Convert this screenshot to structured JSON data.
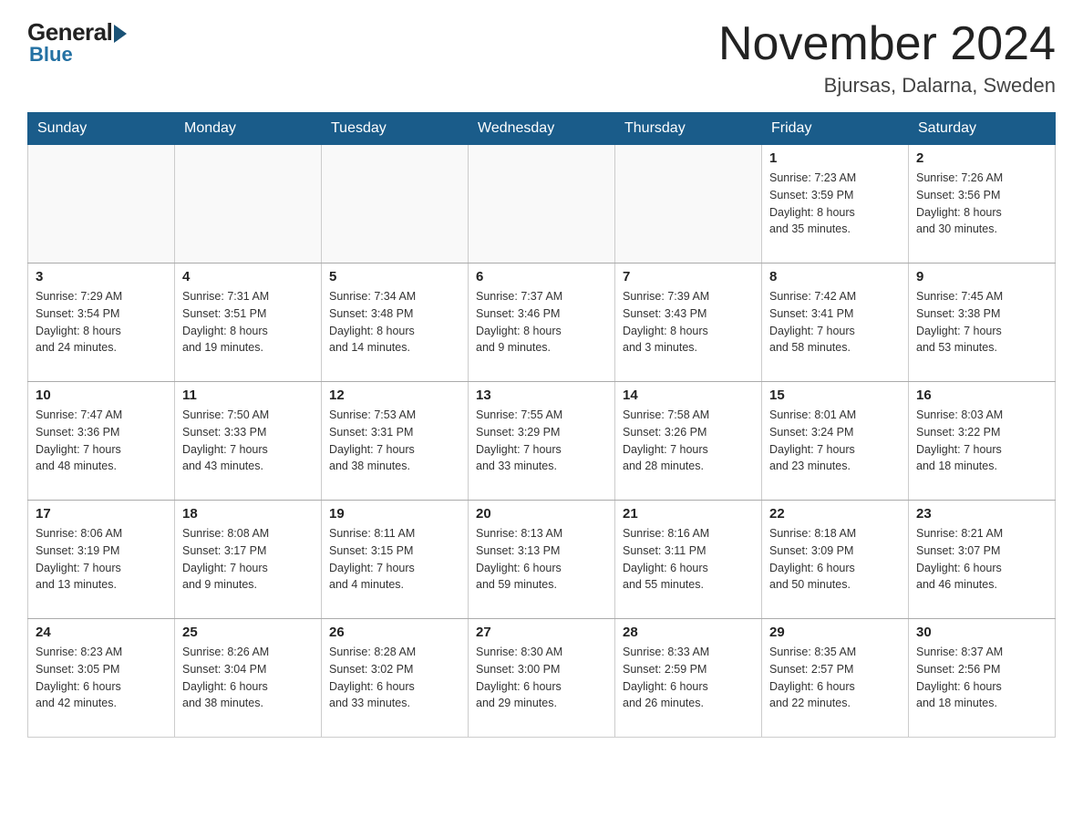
{
  "header": {
    "logo": {
      "general": "General",
      "blue": "Blue"
    },
    "title": "November 2024",
    "location": "Bjursas, Dalarna, Sweden"
  },
  "days_of_week": [
    "Sunday",
    "Monday",
    "Tuesday",
    "Wednesday",
    "Thursday",
    "Friday",
    "Saturday"
  ],
  "weeks": [
    [
      {
        "day": "",
        "info": ""
      },
      {
        "day": "",
        "info": ""
      },
      {
        "day": "",
        "info": ""
      },
      {
        "day": "",
        "info": ""
      },
      {
        "day": "",
        "info": ""
      },
      {
        "day": "1",
        "info": "Sunrise: 7:23 AM\nSunset: 3:59 PM\nDaylight: 8 hours\nand 35 minutes."
      },
      {
        "day": "2",
        "info": "Sunrise: 7:26 AM\nSunset: 3:56 PM\nDaylight: 8 hours\nand 30 minutes."
      }
    ],
    [
      {
        "day": "3",
        "info": "Sunrise: 7:29 AM\nSunset: 3:54 PM\nDaylight: 8 hours\nand 24 minutes."
      },
      {
        "day": "4",
        "info": "Sunrise: 7:31 AM\nSunset: 3:51 PM\nDaylight: 8 hours\nand 19 minutes."
      },
      {
        "day": "5",
        "info": "Sunrise: 7:34 AM\nSunset: 3:48 PM\nDaylight: 8 hours\nand 14 minutes."
      },
      {
        "day": "6",
        "info": "Sunrise: 7:37 AM\nSunset: 3:46 PM\nDaylight: 8 hours\nand 9 minutes."
      },
      {
        "day": "7",
        "info": "Sunrise: 7:39 AM\nSunset: 3:43 PM\nDaylight: 8 hours\nand 3 minutes."
      },
      {
        "day": "8",
        "info": "Sunrise: 7:42 AM\nSunset: 3:41 PM\nDaylight: 7 hours\nand 58 minutes."
      },
      {
        "day": "9",
        "info": "Sunrise: 7:45 AM\nSunset: 3:38 PM\nDaylight: 7 hours\nand 53 minutes."
      }
    ],
    [
      {
        "day": "10",
        "info": "Sunrise: 7:47 AM\nSunset: 3:36 PM\nDaylight: 7 hours\nand 48 minutes."
      },
      {
        "day": "11",
        "info": "Sunrise: 7:50 AM\nSunset: 3:33 PM\nDaylight: 7 hours\nand 43 minutes."
      },
      {
        "day": "12",
        "info": "Sunrise: 7:53 AM\nSunset: 3:31 PM\nDaylight: 7 hours\nand 38 minutes."
      },
      {
        "day": "13",
        "info": "Sunrise: 7:55 AM\nSunset: 3:29 PM\nDaylight: 7 hours\nand 33 minutes."
      },
      {
        "day": "14",
        "info": "Sunrise: 7:58 AM\nSunset: 3:26 PM\nDaylight: 7 hours\nand 28 minutes."
      },
      {
        "day": "15",
        "info": "Sunrise: 8:01 AM\nSunset: 3:24 PM\nDaylight: 7 hours\nand 23 minutes."
      },
      {
        "day": "16",
        "info": "Sunrise: 8:03 AM\nSunset: 3:22 PM\nDaylight: 7 hours\nand 18 minutes."
      }
    ],
    [
      {
        "day": "17",
        "info": "Sunrise: 8:06 AM\nSunset: 3:19 PM\nDaylight: 7 hours\nand 13 minutes."
      },
      {
        "day": "18",
        "info": "Sunrise: 8:08 AM\nSunset: 3:17 PM\nDaylight: 7 hours\nand 9 minutes."
      },
      {
        "day": "19",
        "info": "Sunrise: 8:11 AM\nSunset: 3:15 PM\nDaylight: 7 hours\nand 4 minutes."
      },
      {
        "day": "20",
        "info": "Sunrise: 8:13 AM\nSunset: 3:13 PM\nDaylight: 6 hours\nand 59 minutes."
      },
      {
        "day": "21",
        "info": "Sunrise: 8:16 AM\nSunset: 3:11 PM\nDaylight: 6 hours\nand 55 minutes."
      },
      {
        "day": "22",
        "info": "Sunrise: 8:18 AM\nSunset: 3:09 PM\nDaylight: 6 hours\nand 50 minutes."
      },
      {
        "day": "23",
        "info": "Sunrise: 8:21 AM\nSunset: 3:07 PM\nDaylight: 6 hours\nand 46 minutes."
      }
    ],
    [
      {
        "day": "24",
        "info": "Sunrise: 8:23 AM\nSunset: 3:05 PM\nDaylight: 6 hours\nand 42 minutes."
      },
      {
        "day": "25",
        "info": "Sunrise: 8:26 AM\nSunset: 3:04 PM\nDaylight: 6 hours\nand 38 minutes."
      },
      {
        "day": "26",
        "info": "Sunrise: 8:28 AM\nSunset: 3:02 PM\nDaylight: 6 hours\nand 33 minutes."
      },
      {
        "day": "27",
        "info": "Sunrise: 8:30 AM\nSunset: 3:00 PM\nDaylight: 6 hours\nand 29 minutes."
      },
      {
        "day": "28",
        "info": "Sunrise: 8:33 AM\nSunset: 2:59 PM\nDaylight: 6 hours\nand 26 minutes."
      },
      {
        "day": "29",
        "info": "Sunrise: 8:35 AM\nSunset: 2:57 PM\nDaylight: 6 hours\nand 22 minutes."
      },
      {
        "day": "30",
        "info": "Sunrise: 8:37 AM\nSunset: 2:56 PM\nDaylight: 6 hours\nand 18 minutes."
      }
    ]
  ]
}
